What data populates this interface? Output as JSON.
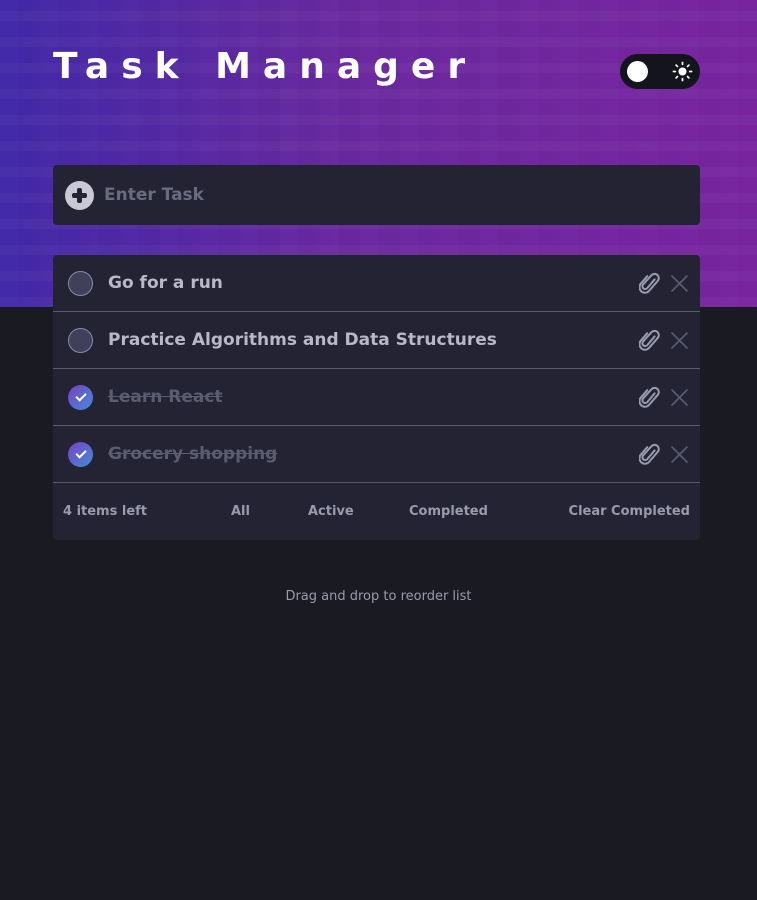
{
  "app": {
    "title": "Task Manager"
  },
  "new_task": {
    "placeholder": "Enter Task"
  },
  "tasks": [
    {
      "text": "Go for a run",
      "completed": false
    },
    {
      "text": "Practice Algorithms and Data Structures",
      "completed": false
    },
    {
      "text": "Learn React",
      "completed": true
    },
    {
      "text": "Grocery shopping",
      "completed": true
    }
  ],
  "footer": {
    "items_left": "4 items left",
    "filter_all": "All",
    "filter_active": "Active",
    "filter_completed": "Completed",
    "clear_completed": "Clear Completed"
  },
  "hint": "Drag and drop to reorder list",
  "icons": {
    "theme": "sun-icon",
    "add": "plus-icon",
    "attach": "paperclip-icon",
    "delete": "close-icon"
  },
  "colors": {
    "accent_from": "#7a3fc4",
    "accent_to": "#3f8fd8",
    "card": "#232333",
    "background": "#1a1a22"
  }
}
